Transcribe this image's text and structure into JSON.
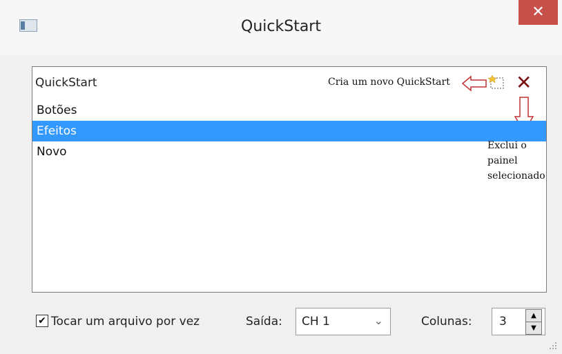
{
  "window": {
    "title": "QuickStart",
    "close_label": "✕"
  },
  "panel": {
    "header_label": "QuickStart",
    "new_annotation": "Cria um novo QuickStart",
    "delete_annotation": [
      "Exclui o",
      "painel",
      "selecionado"
    ],
    "items": [
      {
        "label": "Botões",
        "selected": false
      },
      {
        "label": "Efeitos",
        "selected": true
      },
      {
        "label": "Novo",
        "selected": false
      }
    ]
  },
  "footer": {
    "play_one_label": "Tocar um arquivo por vez",
    "play_one_checked": true,
    "output_label": "Saída:",
    "output_value": "CH 1",
    "columns_label": "Colunas:",
    "columns_value": "3"
  },
  "colors": {
    "selection": "#3399ff",
    "close": "#c7504b",
    "annotation_arrow": "#c23030"
  }
}
